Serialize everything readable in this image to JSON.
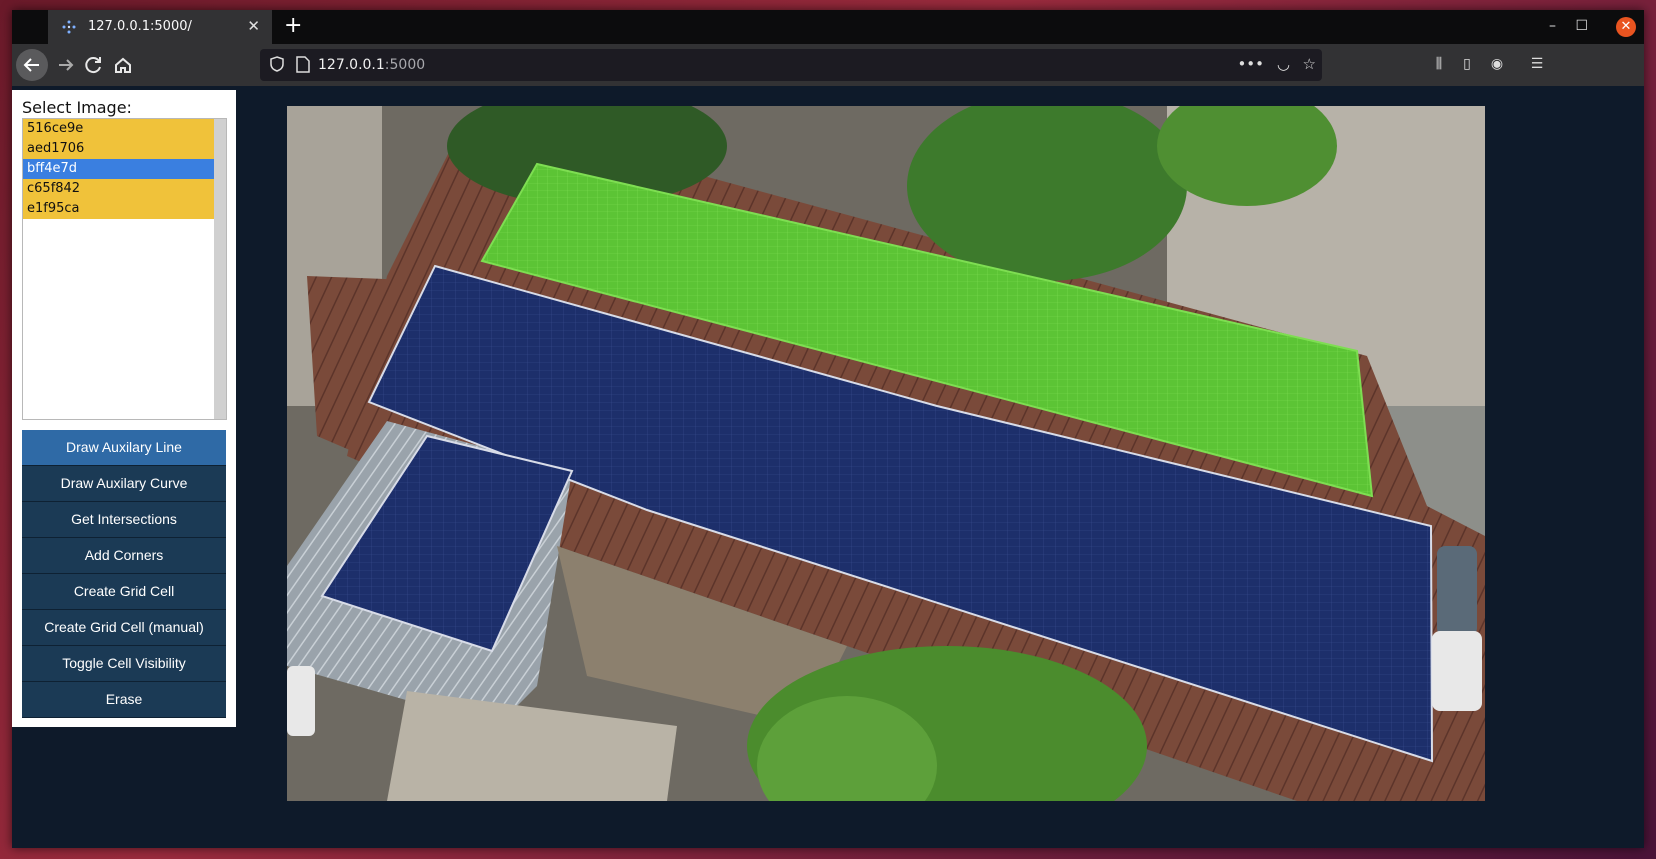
{
  "browser": {
    "tab_title": "127.0.0.1:5000/",
    "url_host": "127.0.0.1",
    "url_port": ":5000"
  },
  "panel": {
    "select_label": "Select Image:",
    "images": [
      {
        "label": "516ce9e",
        "state": "annotated"
      },
      {
        "label": "aed1706",
        "state": "annotated"
      },
      {
        "label": "bff4e7d",
        "state": "selected"
      },
      {
        "label": "c65f842",
        "state": "annotated"
      },
      {
        "label": "e1f95ca",
        "state": "annotated"
      }
    ],
    "buttons": [
      "Draw Auxilary Line",
      "Draw Auxilary Curve",
      "Get Intersections",
      "Add Corners",
      "Create Grid Cell",
      "Create Grid Cell (manual)",
      "Toggle Cell Visibility",
      "Erase"
    ]
  },
  "colors": {
    "annotated": "#f0c23a",
    "selected": "#3a7fe0",
    "button": "#1b3a55",
    "button_active": "#2f6aa6",
    "grid_overlay": "#6ad13a"
  }
}
